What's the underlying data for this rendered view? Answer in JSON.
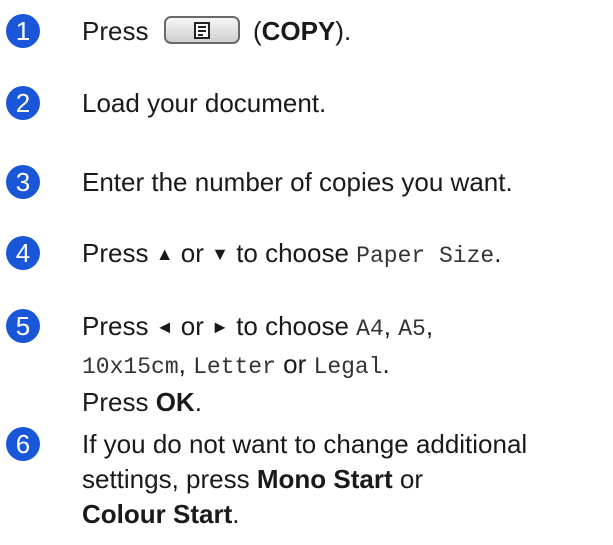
{
  "steps": [
    {
      "number": "1",
      "press": "Press",
      "key_paren_open": "(",
      "key_name": "COPY",
      "key_paren_close": ")."
    },
    {
      "number": "2",
      "text": "Load your document."
    },
    {
      "number": "3",
      "text": "Enter the number of copies you want."
    },
    {
      "number": "4",
      "press": "Press",
      "up_arrow": "▲",
      "or": "or",
      "down_arrow": "▼",
      "to_choose": "to choose",
      "menu_item": "Paper Size",
      "period": "."
    },
    {
      "number": "5",
      "press": "Press",
      "left_arrow": "◄",
      "or": "or",
      "right_arrow": "►",
      "to_choose": "to choose",
      "option_a4": "A4",
      "comma1": ",",
      "option_a5": "A5",
      "comma2": ",",
      "option_10x15": "10x15cm",
      "comma3": ",",
      "option_letter": "Letter",
      "or2": "or",
      "option_legal": "Legal",
      "period": ".",
      "press2": "Press",
      "ok_key": "OK",
      "period2": "."
    },
    {
      "number": "6",
      "line1": "If you do not want to change additional",
      "line2_prefix": "settings, press",
      "mono_start": "Mono Start",
      "or": "or",
      "colour_start": "Colour Start",
      "period": "."
    }
  ],
  "colors": {
    "step_badge": "#1a57d8"
  },
  "icons": {
    "copy_key": "copy-document-icon"
  }
}
